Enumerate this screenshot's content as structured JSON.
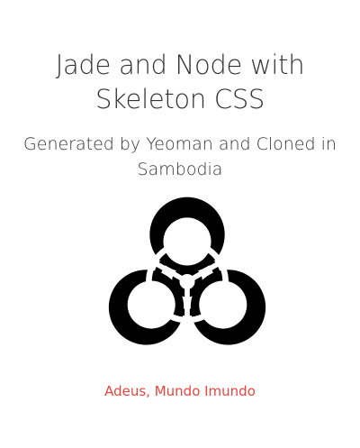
{
  "header": {
    "title_line1": "Jade and Node with",
    "title_line2": "Skeleton CSS",
    "subtitle_line1": "Generated by Yeoman and Cloned in",
    "subtitle_line2": "Sambodia"
  },
  "logo": {
    "icon": "biohazard-icon",
    "color": "#000000"
  },
  "footer": {
    "link_text": "Adeus, Mundo Imundo",
    "link_color": "#e8453c"
  }
}
